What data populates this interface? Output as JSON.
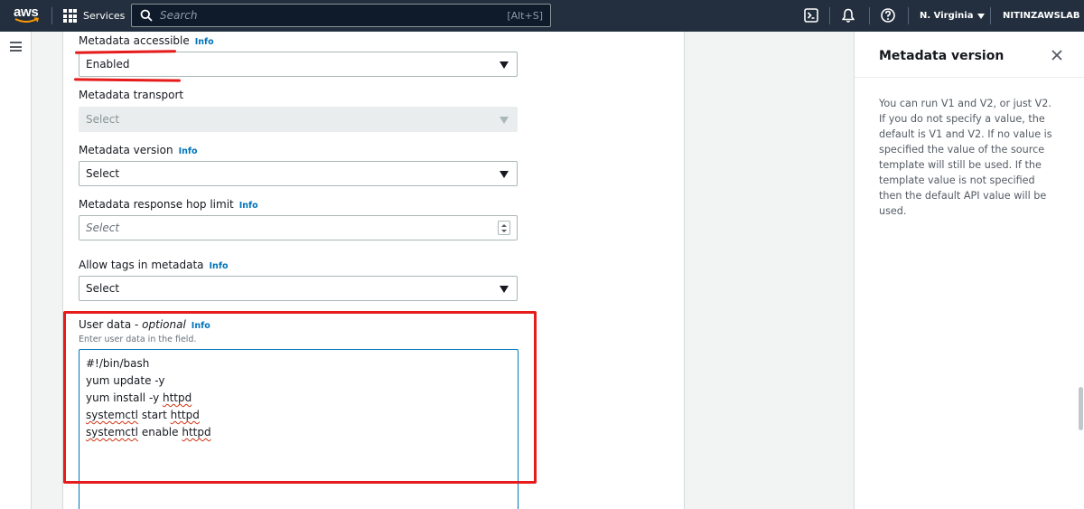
{
  "topnav": {
    "logo_text": "aws",
    "services_label": "Services",
    "search_placeholder": "Search",
    "search_shortcut": "[Alt+S]",
    "icons": [
      "cloudshell-icon",
      "bell-icon",
      "help-icon"
    ],
    "region": "N. Virginia",
    "account": "NITINZAWSLAB"
  },
  "form": {
    "metadata_accessible": {
      "label": "Metadata accessible",
      "info": "Info",
      "value": "Enabled"
    },
    "metadata_transport": {
      "label": "Metadata transport",
      "value": "Select",
      "disabled": true
    },
    "metadata_version": {
      "label": "Metadata version",
      "info": "Info",
      "value": "Select"
    },
    "hop_limit": {
      "label": "Metadata response hop limit",
      "info": "Info",
      "placeholder": "Select"
    },
    "allow_tags": {
      "label": "Allow tags in metadata",
      "info": "Info",
      "value": "Select"
    },
    "user_data": {
      "label": "User data - ",
      "label_optional": "optional",
      "info": "Info",
      "description": "Enter user data in the field.",
      "lines": [
        "#!/bin/bash",
        "yum update -y",
        "yum install -y ",
        "httpd",
        "systemctl",
        " start ",
        "httpd",
        "systemctl",
        " enable ",
        "httpd"
      ]
    }
  },
  "help_panel": {
    "title": "Metadata version",
    "body": "You can run V1 and V2, or just V2. If you do not specify a value, the default is V1 and V2. If no value is specified the value of the source template will still be used. If the template value is not specified then the default API value will be used."
  },
  "colors": {
    "nav_bg": "#232f3e",
    "link": "#0073bb",
    "annotation_red": "#e61b1b",
    "focus_border": "#0073bb"
  }
}
